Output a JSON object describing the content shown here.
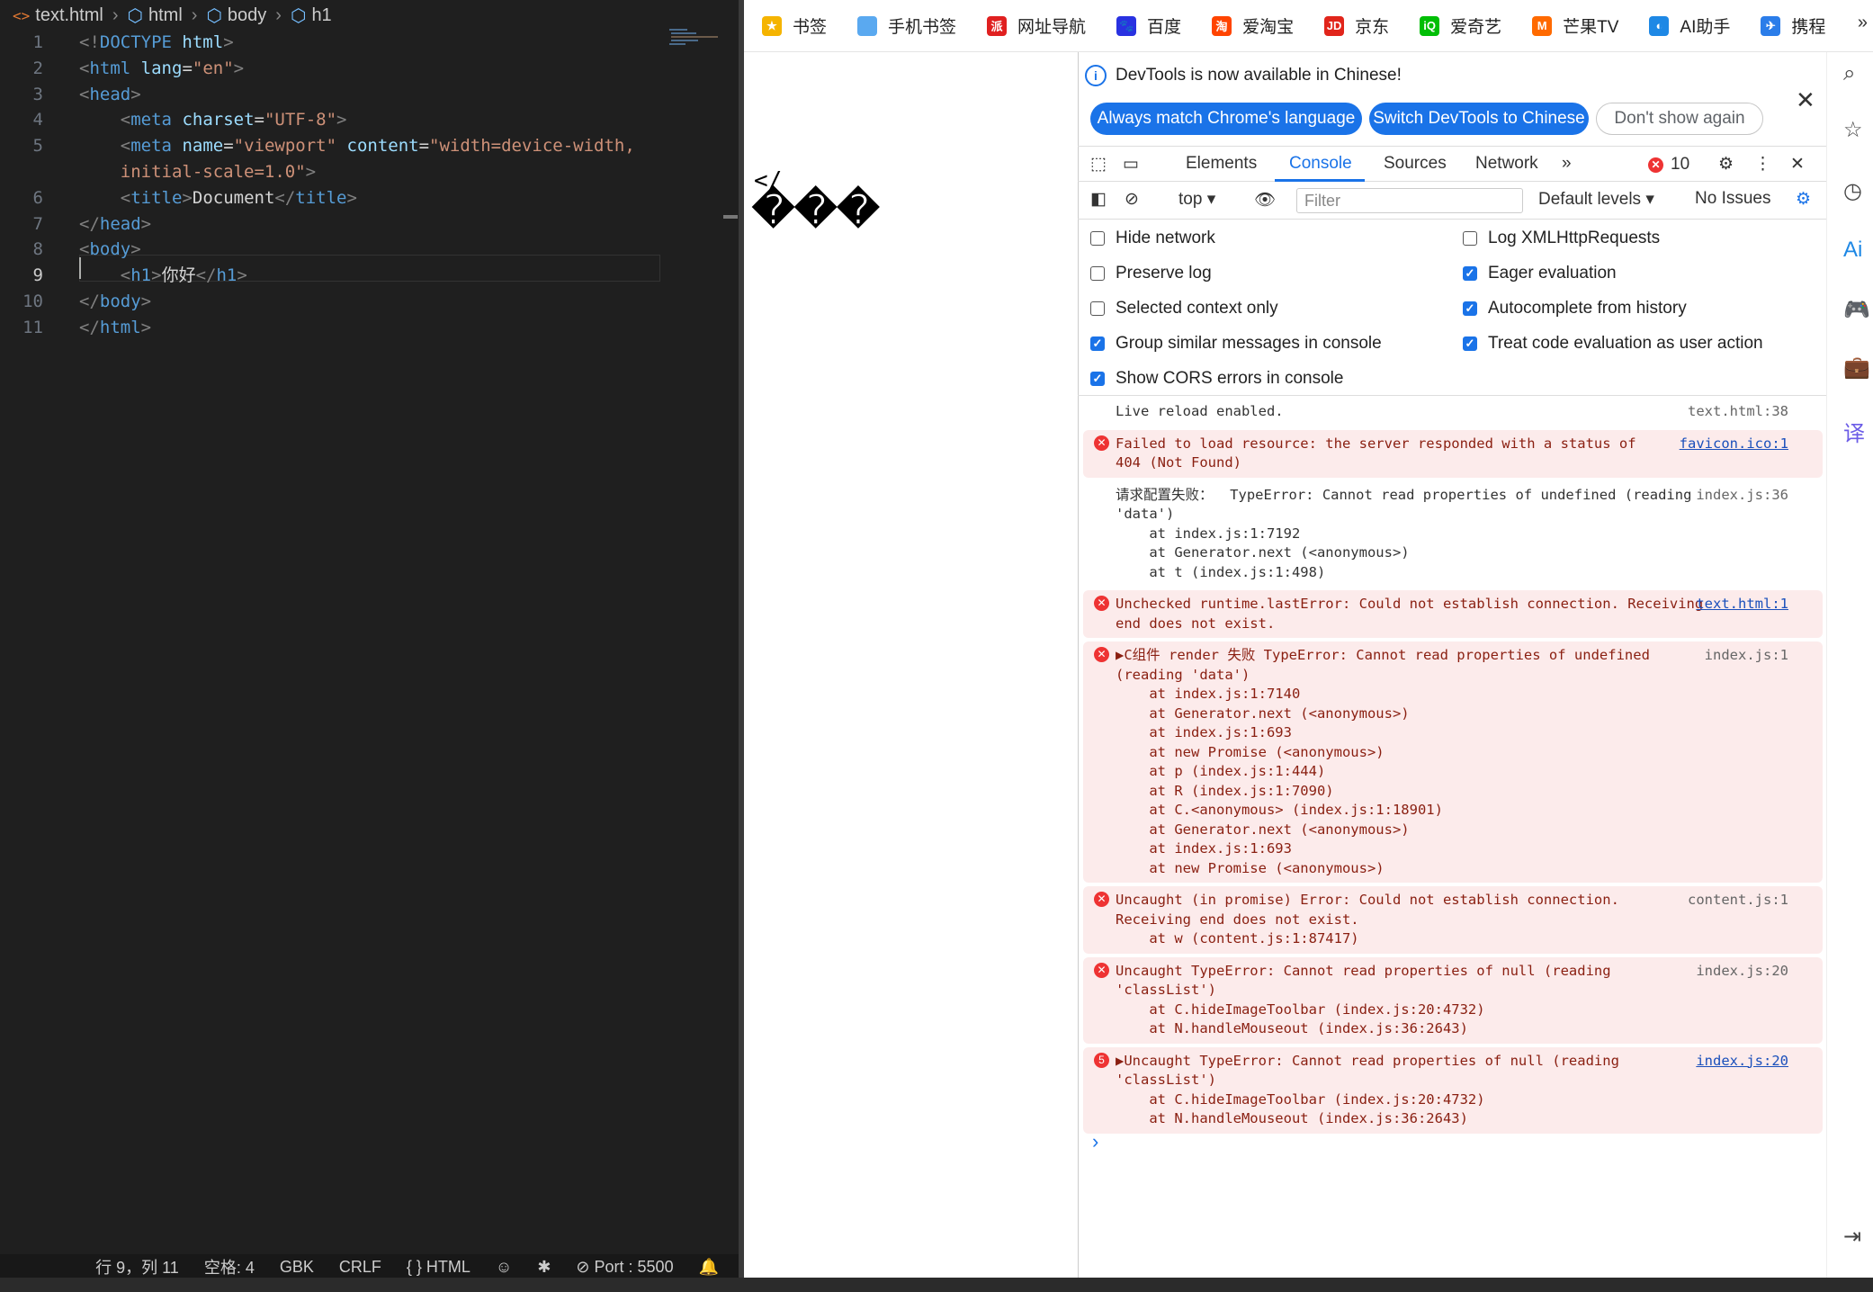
{
  "editor": {
    "breadcrumb": [
      "text.html",
      "html",
      "body",
      "h1"
    ],
    "lines": [
      {
        "n": "1",
        "parts": [
          [
            "p",
            "<!"
          ],
          [
            "t",
            "DOCTYPE"
          ],
          [
            "x",
            " "
          ],
          [
            "a",
            "html"
          ],
          [
            "p",
            ">"
          ]
        ]
      },
      {
        "n": "2",
        "parts": [
          [
            "p",
            "<"
          ],
          [
            "t",
            "html"
          ],
          [
            "x",
            " "
          ],
          [
            "a",
            "lang"
          ],
          [
            "x",
            "="
          ],
          [
            "s",
            "\"en\""
          ],
          [
            "p",
            ">"
          ]
        ]
      },
      {
        "n": "3",
        "parts": [
          [
            "p",
            "<"
          ],
          [
            "t",
            "head"
          ],
          [
            "p",
            ">"
          ]
        ]
      },
      {
        "n": "4",
        "parts": [
          [
            "x",
            "    "
          ],
          [
            "p",
            "<"
          ],
          [
            "t",
            "meta"
          ],
          [
            "x",
            " "
          ],
          [
            "a",
            "charset"
          ],
          [
            "x",
            "="
          ],
          [
            "s",
            "\"UTF-8\""
          ],
          [
            "p",
            ">"
          ]
        ]
      },
      {
        "n": "5",
        "parts": [
          [
            "x",
            "    "
          ],
          [
            "p",
            "<"
          ],
          [
            "t",
            "meta"
          ],
          [
            "x",
            " "
          ],
          [
            "a",
            "name"
          ],
          [
            "x",
            "="
          ],
          [
            "s",
            "\"viewport\""
          ],
          [
            "x",
            " "
          ],
          [
            "a",
            "content"
          ],
          [
            "x",
            "="
          ],
          [
            "s",
            "\"width=device-width,"
          ]
        ]
      },
      {
        "n": "",
        "parts": [
          [
            "s",
            "    initial-scale=1.0\""
          ],
          [
            "p",
            ">"
          ]
        ]
      },
      {
        "n": "6",
        "parts": [
          [
            "x",
            "    "
          ],
          [
            "p",
            "<"
          ],
          [
            "t",
            "title"
          ],
          [
            "p",
            ">"
          ],
          [
            "x",
            "Document"
          ],
          [
            "p",
            "</"
          ],
          [
            "t",
            "title"
          ],
          [
            "p",
            ">"
          ]
        ]
      },
      {
        "n": "7",
        "parts": [
          [
            "p",
            "</"
          ],
          [
            "t",
            "head"
          ],
          [
            "p",
            ">"
          ]
        ]
      },
      {
        "n": "8",
        "parts": [
          [
            "p",
            "<"
          ],
          [
            "t",
            "body"
          ],
          [
            "p",
            ">"
          ]
        ]
      },
      {
        "n": "9",
        "parts": [
          [
            "x",
            "    "
          ],
          [
            "p",
            "<"
          ],
          [
            "t",
            "h1"
          ],
          [
            "p",
            ">"
          ],
          [
            "x",
            "你好"
          ],
          [
            "p",
            "</"
          ],
          [
            "t",
            "h1"
          ],
          [
            "p",
            ">"
          ]
        ]
      },
      {
        "n": "10",
        "parts": [
          [
            "p",
            "</"
          ],
          [
            "t",
            "body"
          ],
          [
            "p",
            ">"
          ]
        ]
      },
      {
        "n": "11",
        "parts": [
          [
            "p",
            "</"
          ],
          [
            "t",
            "html"
          ],
          [
            "p",
            ">"
          ]
        ]
      }
    ],
    "status": {
      "position": "行 9，列 11",
      "spaces": "空格: 4",
      "encoding": "GBK",
      "eol": "CRLF",
      "language": "HTML",
      "port": "Port : 5500"
    }
  },
  "bookmarks": [
    {
      "label": "书签",
      "color": "#f5b400",
      "glyph": "★"
    },
    {
      "label": "手机书签",
      "color": "#5aa9f0",
      "glyph": ""
    },
    {
      "label": "网址导航",
      "color": "#e02020",
      "glyph": "派"
    },
    {
      "label": "百度",
      "color": "#2932e1",
      "glyph": "🐾"
    },
    {
      "label": "爱淘宝",
      "color": "#ff4400",
      "glyph": "淘"
    },
    {
      "label": "京东",
      "color": "#e1251b",
      "glyph": "JD"
    },
    {
      "label": "爱奇艺",
      "color": "#00be06",
      "glyph": "iQ"
    },
    {
      "label": "芒果TV",
      "color": "#ff6a00",
      "glyph": "M"
    },
    {
      "label": "AI助手",
      "color": "#1e88e5",
      "glyph": "◐"
    },
    {
      "label": "携程",
      "color": "#2b7de9",
      "glyph": "✈"
    }
  ],
  "page": {
    "heading_glyphs": "���",
    "fragment": "</"
  },
  "devtools": {
    "notice": "DevTools is now available in Chinese!",
    "btn_match": "Always match Chrome's language",
    "btn_switch": "Switch DevTools to Chinese",
    "btn_dismiss": "Don't show again",
    "tabs": [
      "Elements",
      "Console",
      "Sources",
      "Network"
    ],
    "active_tab": "Console",
    "error_count": "10",
    "context": "top",
    "filter_placeholder": "Filter",
    "levels": "Default levels",
    "issues": "No Issues",
    "settings": [
      {
        "label": "Hide network",
        "checked": false
      },
      {
        "label": "Log XMLHttpRequests",
        "checked": false
      },
      {
        "label": "Preserve log",
        "checked": false
      },
      {
        "label": "Eager evaluation",
        "checked": true
      },
      {
        "label": "Selected context only",
        "checked": false
      },
      {
        "label": "Autocomplete from history",
        "checked": true
      },
      {
        "label": "Group similar messages in console",
        "checked": true
      },
      {
        "label": "Treat code evaluation as user action",
        "checked": true
      },
      {
        "label": "Show CORS errors in console",
        "checked": true
      }
    ],
    "messages": [
      {
        "type": "info",
        "lines": [
          "Live reload enabled."
        ],
        "source": "text.html:38",
        "source_link": false
      },
      {
        "type": "error",
        "lines": [
          "Failed to load resource: the server responded with a status of",
          "404 (Not Found)"
        ],
        "source": "favicon.ico:1",
        "source_link": true
      },
      {
        "type": "info",
        "lines": [
          "请求配置失败：  TypeError: Cannot read properties of undefined (reading",
          "'data')",
          "    at index.js:1:7192",
          "    at Generator.next (<anonymous>)",
          "    at t (index.js:1:498)"
        ],
        "source": "index.js:36",
        "source_link": false
      },
      {
        "type": "error",
        "lines": [
          "Unchecked runtime.lastError: Could not establish connection. Receiving",
          "end does not exist."
        ],
        "source": "text.html:1",
        "source_link": true
      },
      {
        "type": "error",
        "lines": [
          "▶C组件 render 失败 TypeError: Cannot read properties of undefined",
          "(reading 'data')",
          "    at index.js:1:7140",
          "    at Generator.next (<anonymous>)",
          "    at index.js:1:693",
          "    at new Promise (<anonymous>)",
          "    at p (index.js:1:444)",
          "    at R (index.js:1:7090)",
          "    at C.<anonymous> (index.js:1:18901)",
          "    at Generator.next (<anonymous>)",
          "    at index.js:1:693",
          "    at new Promise (<anonymous>)"
        ],
        "source": "index.js:1",
        "source_link": false
      },
      {
        "type": "error",
        "lines": [
          "Uncaught (in promise) Error: Could not establish connection.",
          "Receiving end does not exist.",
          "    at w (content.js:1:87417)"
        ],
        "source": "content.js:1",
        "source_link": false
      },
      {
        "type": "error",
        "lines": [
          "Uncaught TypeError: Cannot read properties of null (reading",
          "'classList')",
          "    at C.hideImageToolbar (index.js:20:4732)",
          "    at N.handleMouseout (index.js:36:2643)"
        ],
        "source": "index.js:20",
        "source_link": false
      },
      {
        "type": "error",
        "count": "5",
        "lines": [
          "▶Uncaught TypeError: Cannot read properties of null (reading",
          "'classList')",
          "    at C.hideImageToolbar (index.js:20:4732)",
          "    at N.handleMouseout (index.js:36:2643)"
        ],
        "source": "index.js:20",
        "source_link": true
      }
    ]
  }
}
